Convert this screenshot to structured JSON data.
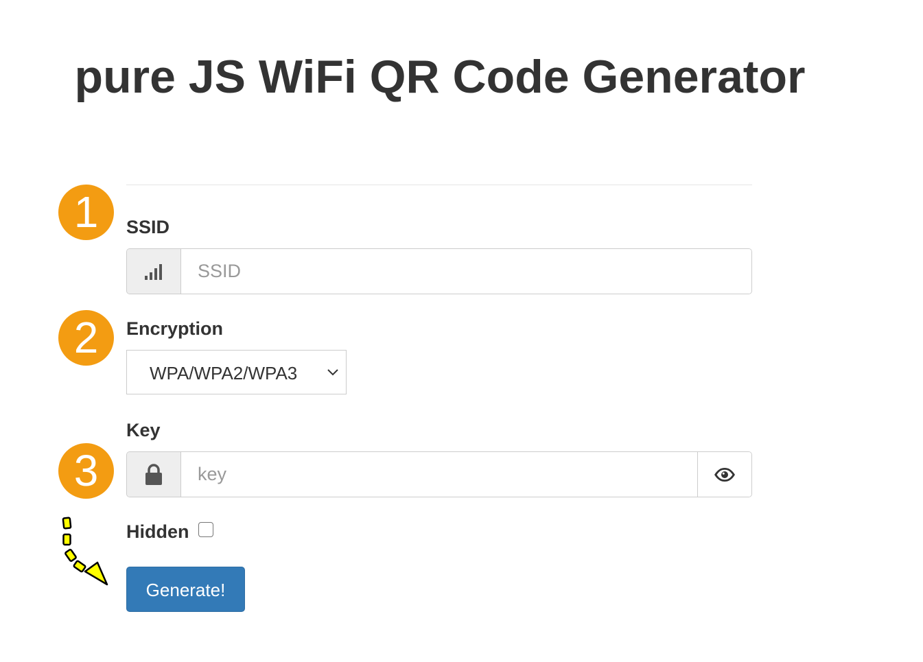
{
  "title": "pure JS WiFi QR Code Generator",
  "steps": [
    "1",
    "2",
    "3"
  ],
  "ssid": {
    "label": "SSID",
    "placeholder": "SSID",
    "value": "",
    "icon": "signal-icon"
  },
  "encryption": {
    "label": "Encryption",
    "selected": "WPA/WPA2/WPA3"
  },
  "key": {
    "label": "Key",
    "placeholder": "key",
    "value": "",
    "icon": "lock-icon",
    "toggle_icon": "eye-icon"
  },
  "hidden": {
    "label": "Hidden",
    "checked": false
  },
  "generate_button": "Generate!",
  "colors": {
    "badge": "#f39c12",
    "button": "#337ab7",
    "arrow": "#ffff00"
  }
}
